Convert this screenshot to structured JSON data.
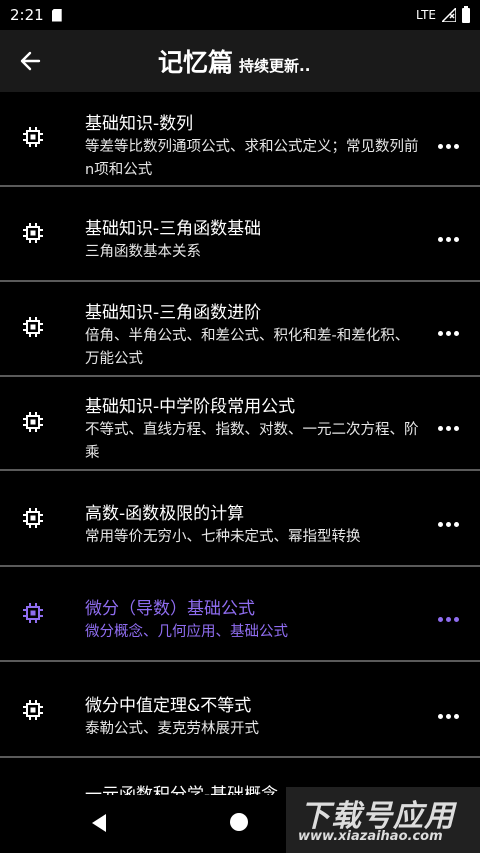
{
  "status": {
    "time": "2:21",
    "network": "LTE"
  },
  "appbar": {
    "title": "记忆篇",
    "subtitle": "持续更新.."
  },
  "items": [
    {
      "title": "基础知识-数列",
      "desc": "等差等比数列通项公式、求和公式定义；常见数列前n项和公式",
      "active": false
    },
    {
      "title": "基础知识-三角函数基础",
      "desc": "三角函数基本关系",
      "active": false
    },
    {
      "title": "基础知识-三角函数进阶",
      "desc": "倍角、半角公式、和差公式、积化和差-和差化积、万能公式",
      "active": false
    },
    {
      "title": "基础知识-中学阶段常用公式",
      "desc": "不等式、直线方程、指数、对数、一元二次方程、阶乘",
      "active": false
    },
    {
      "title": "高数-函数极限的计算",
      "desc": "常用等价无穷小、七种未定式、幂指型转换",
      "active": false
    },
    {
      "title": "微分（导数）基础公式",
      "desc": "微分概念、几何应用、基础公式",
      "active": true
    },
    {
      "title": "微分中值定理&不等式",
      "desc": "泰勒公式、麦克劳林展开式",
      "active": false
    }
  ],
  "partial_item": {
    "title": "一元函数积分学-基础概念"
  },
  "watermark": {
    "big": "下载号应用",
    "small": "www.xiazaihao.com"
  },
  "colors": {
    "accent": "#8f6df0",
    "appbar": "#1a1a1a",
    "divider": "#5a5a5a"
  },
  "icons": {
    "item": "chip-icon",
    "more": "more-horizontal-icon",
    "back": "arrow-left-icon"
  }
}
